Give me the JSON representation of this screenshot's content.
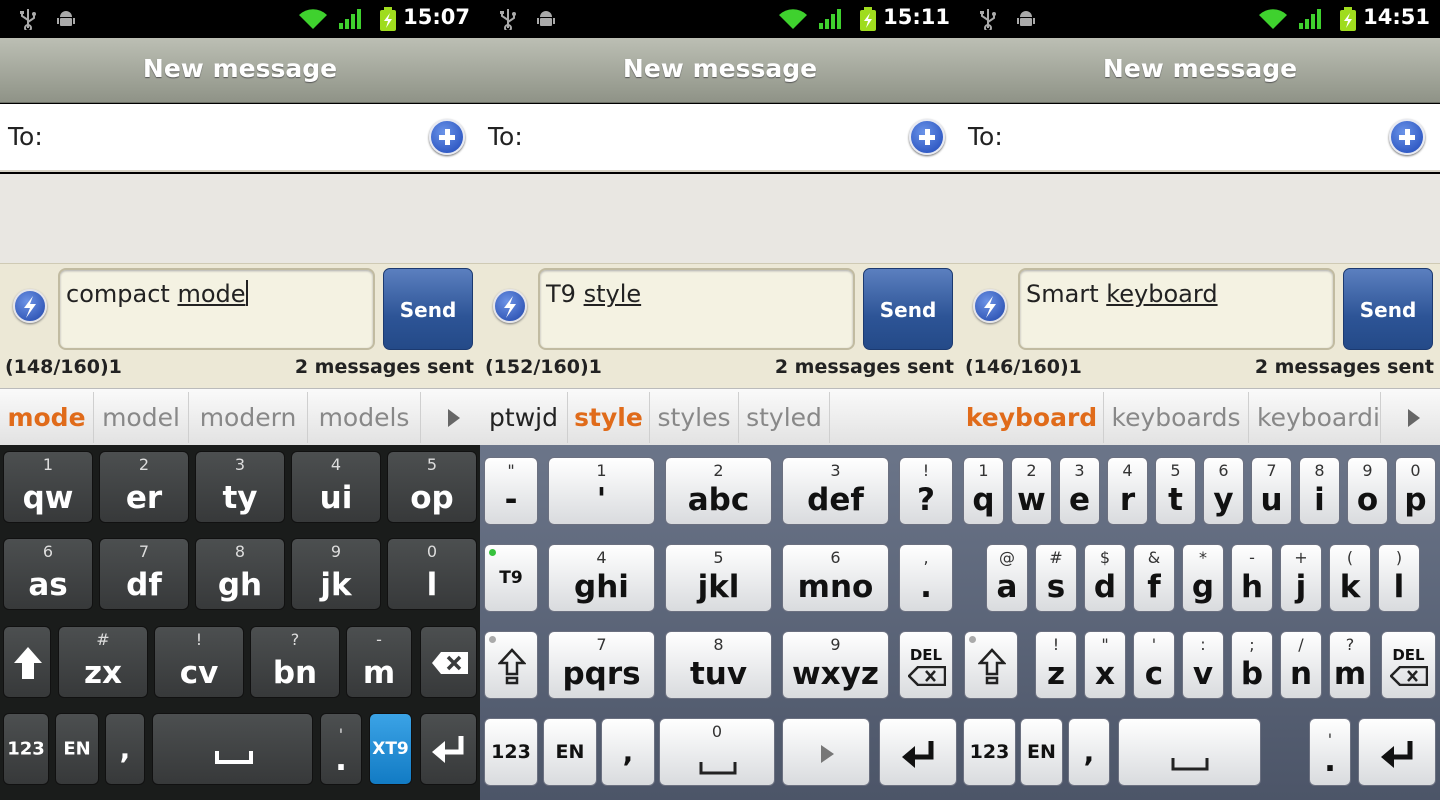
{
  "screens": [
    {
      "time": "15:07",
      "title": "New message",
      "to_label": "To:",
      "message": {
        "word1": "compact",
        "word2": "mode"
      },
      "counter": "(148/160)1",
      "sent": "2 messages sent",
      "send_label": "Send",
      "suggestions": [
        "mode",
        "model",
        "modern",
        "models"
      ],
      "keyboard": {
        "row1": [
          {
            "sup": "1",
            "main": "qw"
          },
          {
            "sup": "2",
            "main": "er"
          },
          {
            "sup": "3",
            "main": "ty"
          },
          {
            "sup": "4",
            "main": "ui"
          },
          {
            "sup": "5",
            "main": "op"
          }
        ],
        "row2": [
          {
            "sup": "6",
            "main": "as"
          },
          {
            "sup": "7",
            "main": "df"
          },
          {
            "sup": "8",
            "main": "gh"
          },
          {
            "sup": "9",
            "main": "jk"
          },
          {
            "sup": "0",
            "main": "l"
          }
        ],
        "row3": [
          {
            "sup": "#",
            "main": "zx"
          },
          {
            "sup": "!",
            "main": "cv"
          },
          {
            "sup": "?",
            "main": "bn"
          },
          {
            "sup": "-",
            "main": "m"
          }
        ],
        "row4": {
          "num": "123",
          "lang": "EN",
          "comma": ",",
          "period_sup": "'",
          "period": ".",
          "mode": "XT9"
        }
      }
    },
    {
      "time": "15:11",
      "title": "New message",
      "to_label": "To:",
      "message": {
        "word1": "T9",
        "word2": "style"
      },
      "counter": "(152/160)1",
      "sent": "2 messages sent",
      "send_label": "Send",
      "suggestions": [
        "ptwjd",
        "style",
        "styles",
        "styled"
      ],
      "keyboard": {
        "row1": [
          {
            "sup": "\"",
            "main": "-"
          },
          {
            "sup": "1",
            "main": "'"
          },
          {
            "sup": "2",
            "main": "abc"
          },
          {
            "sup": "3",
            "main": "def"
          },
          {
            "sup": "!",
            "main": "?"
          }
        ],
        "row2": [
          {
            "sup": "",
            "main": "T9"
          },
          {
            "sup": "4",
            "main": "ghi"
          },
          {
            "sup": "5",
            "main": "jkl"
          },
          {
            "sup": "6",
            "main": "mno"
          },
          {
            "sup": ",",
            "main": "."
          }
        ],
        "row3": [
          {
            "sup": "7",
            "main": "pqrs"
          },
          {
            "sup": "8",
            "main": "tuv"
          },
          {
            "sup": "9",
            "main": "wxyz"
          }
        ],
        "del": "DEL",
        "row4": {
          "num": "123",
          "lang": "EN",
          "comma": ",",
          "space_sup": "0"
        }
      }
    },
    {
      "time": "14:51",
      "title": "New message",
      "to_label": "To:",
      "message": {
        "word1": "Smart",
        "word2": "keyboard"
      },
      "counter": "(146/160)1",
      "sent": "2 messages sent",
      "send_label": "Send",
      "suggestions": [
        "keyboard",
        "keyboards",
        "keyboardi"
      ],
      "keyboard": {
        "row1": [
          {
            "sup": "1",
            "main": "q"
          },
          {
            "sup": "2",
            "main": "w"
          },
          {
            "sup": "3",
            "main": "e"
          },
          {
            "sup": "4",
            "main": "r"
          },
          {
            "sup": "5",
            "main": "t"
          },
          {
            "sup": "6",
            "main": "y"
          },
          {
            "sup": "7",
            "main": "u"
          },
          {
            "sup": "8",
            "main": "i"
          },
          {
            "sup": "9",
            "main": "o"
          },
          {
            "sup": "0",
            "main": "p"
          }
        ],
        "row2": [
          {
            "sup": "@",
            "main": "a"
          },
          {
            "sup": "#",
            "main": "s"
          },
          {
            "sup": "$",
            "main": "d"
          },
          {
            "sup": "&",
            "main": "f"
          },
          {
            "sup": "*",
            "main": "g"
          },
          {
            "sup": "-",
            "main": "h"
          },
          {
            "sup": "+",
            "main": "j"
          },
          {
            "sup": "(",
            "main": "k"
          },
          {
            "sup": ")",
            "main": "l"
          }
        ],
        "row3": [
          {
            "sup": "!",
            "main": "z"
          },
          {
            "sup": "\"",
            "main": "x"
          },
          {
            "sup": "'",
            "main": "c"
          },
          {
            "sup": ":",
            "main": "v"
          },
          {
            "sup": ";",
            "main": "b"
          },
          {
            "sup": "/",
            "main": "n"
          },
          {
            "sup": "?",
            "main": "m"
          }
        ],
        "del": "DEL",
        "row4": {
          "num": "123",
          "lang": "EN",
          "comma": ",",
          "period_sup": "'",
          "period": "."
        }
      }
    }
  ],
  "icons": {
    "usb": "usb-icon",
    "android": "android-debug-icon",
    "wifi": "wifi-icon",
    "signal": "signal-icon",
    "battery": "battery-charging-icon",
    "add": "add-contact-icon",
    "bolt": "quick-text-icon",
    "shift": "shift-icon",
    "backspace": "backspace-icon",
    "enter": "enter-icon",
    "space": "space-icon",
    "arrow": "more-suggestions-icon"
  },
  "colors": {
    "suggestion_selected": "#e06b1a",
    "send_button": "#2d5496",
    "xt9_key": "#127bc4",
    "title_bar": "#a5a89d"
  }
}
